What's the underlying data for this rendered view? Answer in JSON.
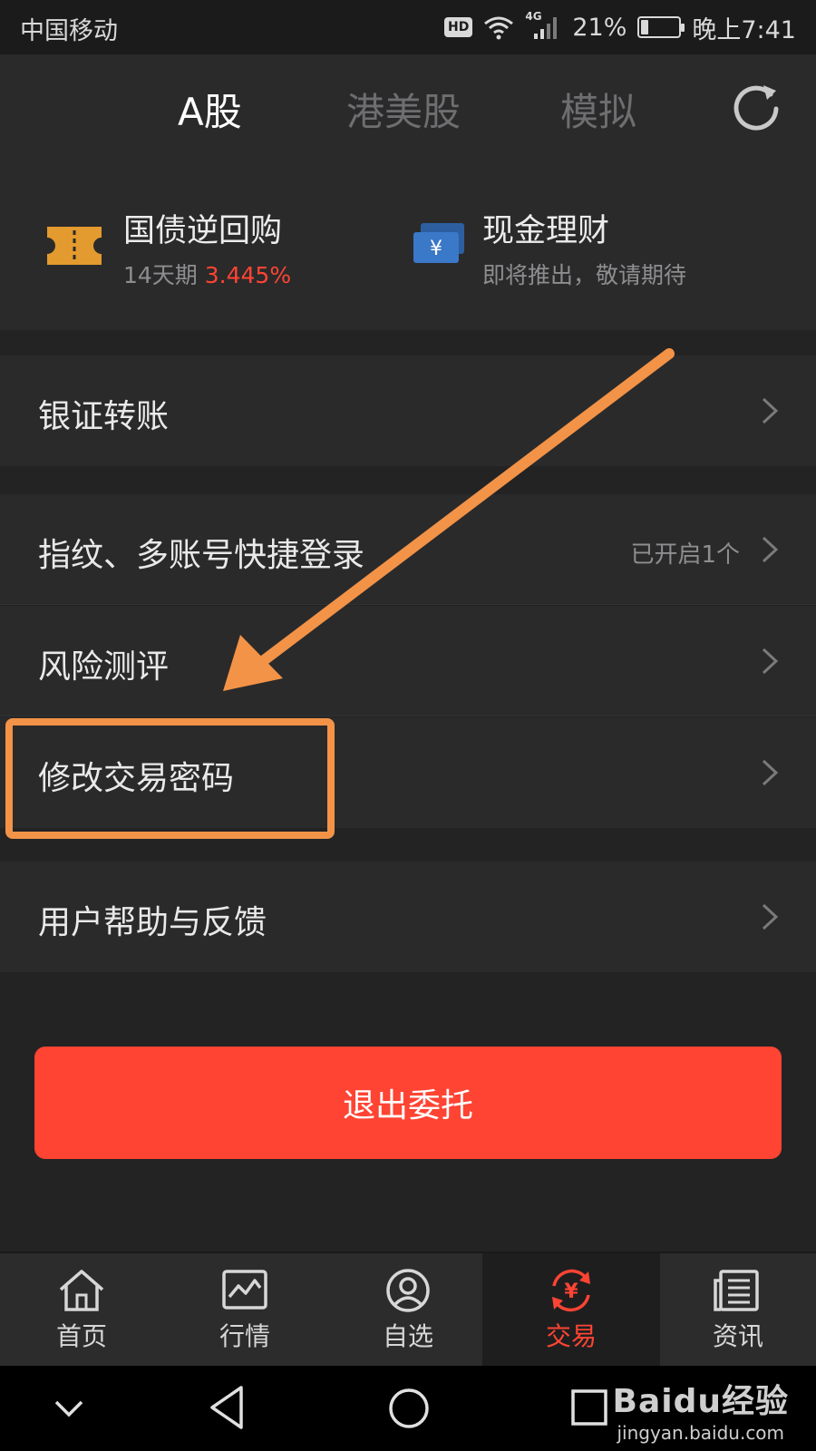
{
  "status_bar": {
    "carrier": "中国移动",
    "hd": "HD",
    "network": "4G",
    "battery_text": "21%",
    "battery_level": 0.21,
    "time": "晚上7:41"
  },
  "header": {
    "tabs": [
      {
        "label": "A股",
        "active": true
      },
      {
        "label": "港美股",
        "active": false
      },
      {
        "label": "模拟",
        "active": false
      }
    ]
  },
  "promo": {
    "left": {
      "title": "国债逆回购",
      "period": "14天期",
      "rate": "3.445%",
      "icon": "ticket-icon",
      "icon_color": "#e39a2e"
    },
    "right": {
      "title": "现金理财",
      "subtitle": "即将推出，敬请期待",
      "icon": "yuan-bill-icon",
      "icon_color": "#3a78c8"
    }
  },
  "menu": {
    "bank_transfer": "银证转账",
    "fingerprint_login": "指纹、多账号快捷登录",
    "fingerprint_status": "已开启1个",
    "risk_assessment": "风险测评",
    "change_password": "修改交易密码",
    "help_feedback": "用户帮助与反馈"
  },
  "logout_label": "退出委托",
  "tabbar": {
    "items": [
      {
        "label": "首页",
        "icon": "home-icon"
      },
      {
        "label": "行情",
        "icon": "chart-icon"
      },
      {
        "label": "自选",
        "icon": "user-circle-icon"
      },
      {
        "label": "交易",
        "icon": "yuan-exchange-icon",
        "active": true
      },
      {
        "label": "资讯",
        "icon": "news-icon"
      }
    ]
  },
  "watermark": {
    "brand": "Baidu经验",
    "url": "jingyan.baidu.com"
  },
  "colors": {
    "accent": "#ff4433",
    "annotation": "#f39347",
    "background": "#232324",
    "panel": "#2a2a2b"
  }
}
